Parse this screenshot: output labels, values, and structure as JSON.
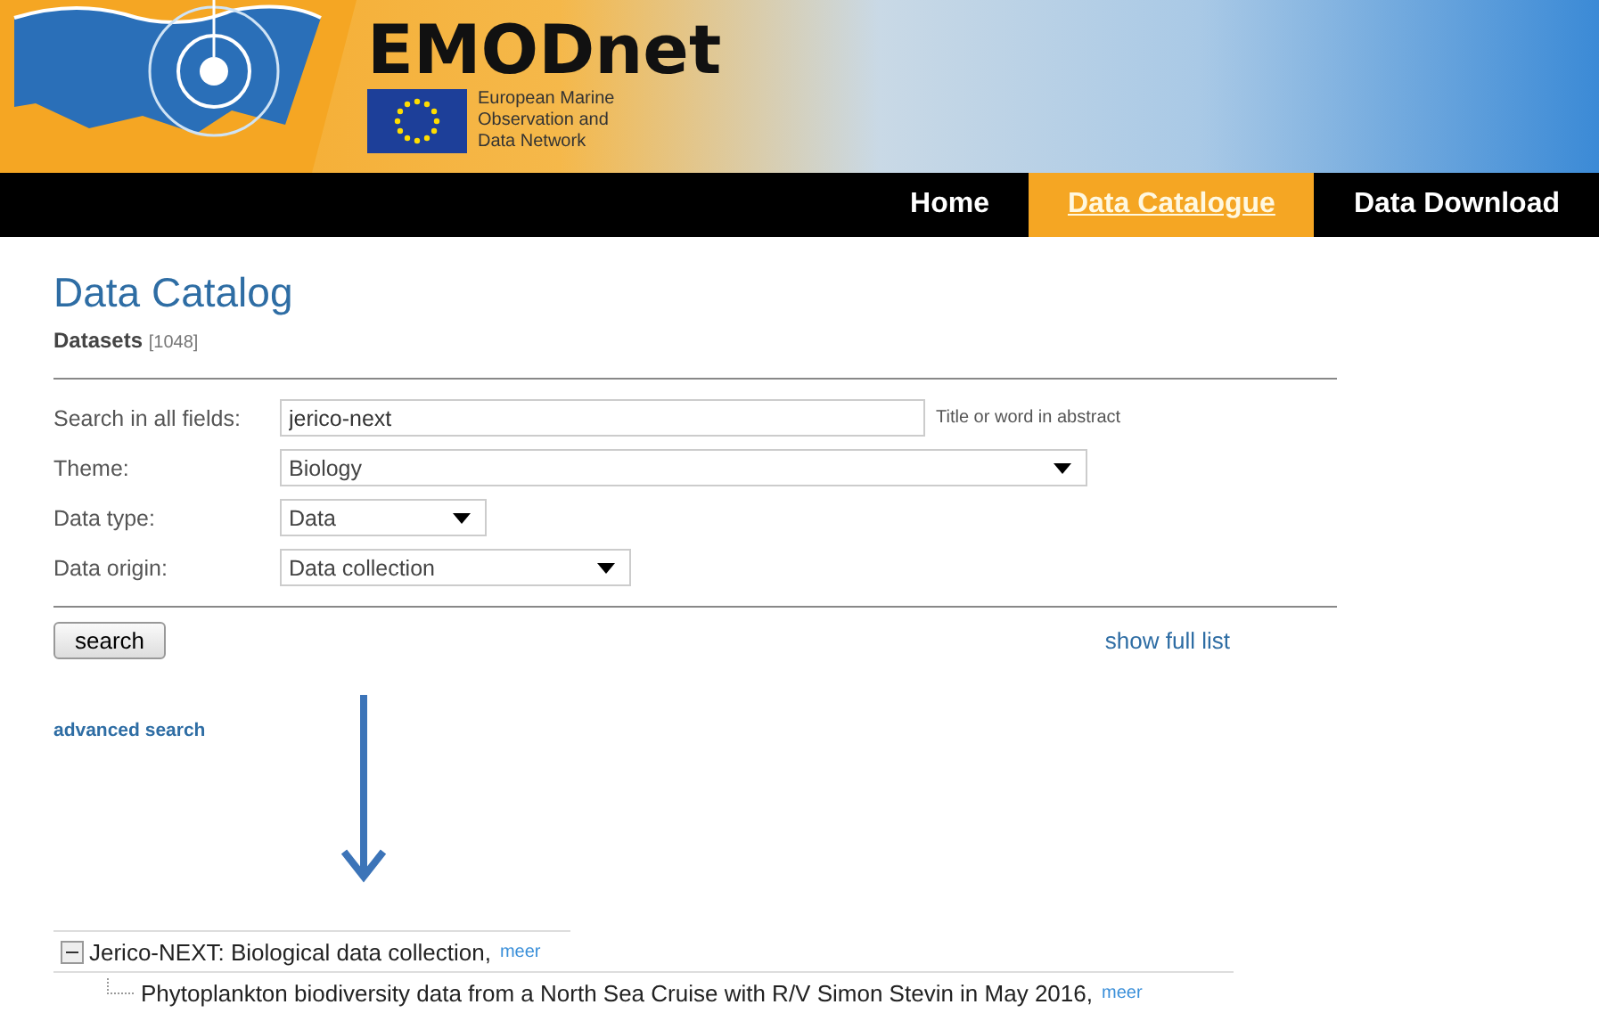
{
  "header": {
    "brand": "EMODnet",
    "subtitle_lines": [
      "European Marine",
      "Observation and",
      "Data Network"
    ]
  },
  "nav": [
    {
      "label": "Home",
      "selected": false
    },
    {
      "label": "Data Catalogue",
      "selected": true
    },
    {
      "label": "Data Download",
      "selected": false
    }
  ],
  "page": {
    "title": "Data Catalog",
    "count_label": "Datasets",
    "count": "[1048]"
  },
  "form": {
    "rows": [
      {
        "kind": "text",
        "label": "Search in all fields:",
        "value": "jerico-next",
        "hint": "Title or word in abstract"
      },
      {
        "kind": "select",
        "label": "Theme:",
        "value": "Biology"
      },
      {
        "kind": "select",
        "label": "Data type:",
        "value": "Data"
      },
      {
        "kind": "select",
        "label": "Data origin:",
        "value": "Data collection"
      }
    ],
    "search_button": "search",
    "show_full_list": "show full list",
    "advanced_search": "advanced search"
  },
  "tree": [
    {
      "label": "Jerico-NEXT: Biological data collection,",
      "link": "meer",
      "expanded": true,
      "children": [
        {
          "label": "Phytoplankton biodiversity data from a North Sea Cruise with R/V Simon Stevin in May 2016,",
          "link": "meer"
        }
      ]
    }
  ]
}
